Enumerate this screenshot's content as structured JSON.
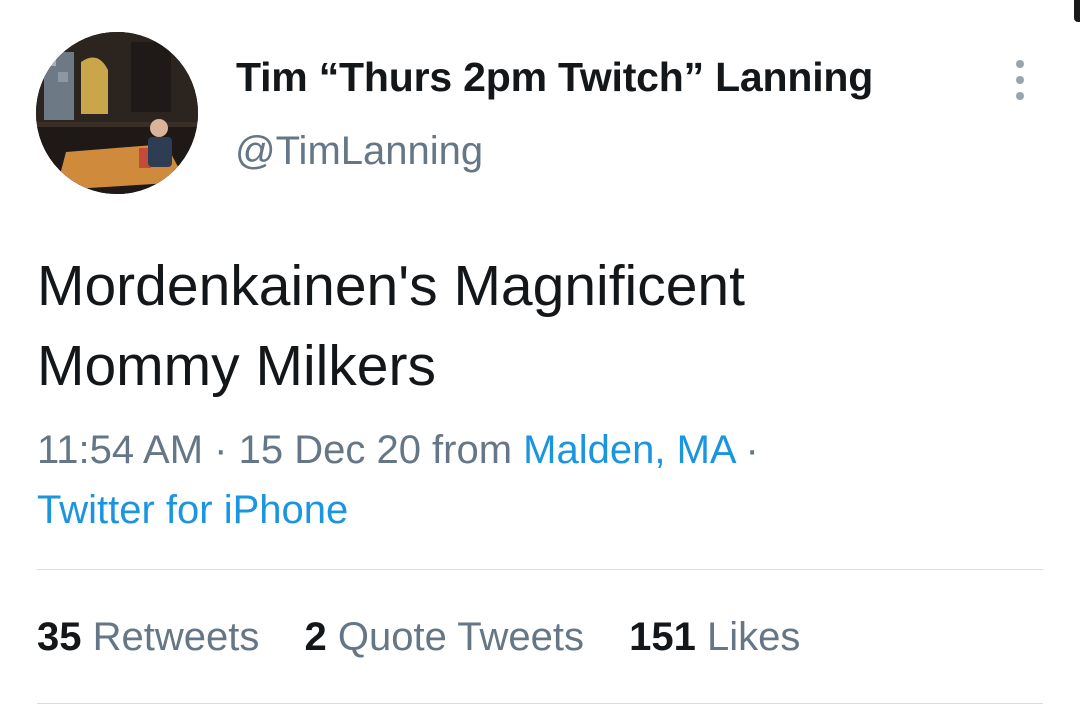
{
  "user": {
    "display_name": "Tim “Thurs 2pm Twitch” Lanning",
    "handle": "@TimLanning"
  },
  "tweet": {
    "text_line1": "Mordenkainen's Magnificent",
    "text_line2": "Mommy Milkers",
    "time": "11:54 AM",
    "separator": " · ",
    "date": "15 Dec 20",
    "from_label": " from ",
    "location": "Malden, MA",
    "source": "Twitter for iPhone"
  },
  "stats": [
    {
      "count": "35",
      "label": "Retweets"
    },
    {
      "count": "2",
      "label": "Quote Tweets"
    },
    {
      "count": "151",
      "label": "Likes"
    }
  ],
  "icons": {
    "more": "more-vertical-icon"
  },
  "colors": {
    "text": "#14171a",
    "secondary": "#657786",
    "link": "#1b95e0",
    "divider": "#d8dde1"
  }
}
